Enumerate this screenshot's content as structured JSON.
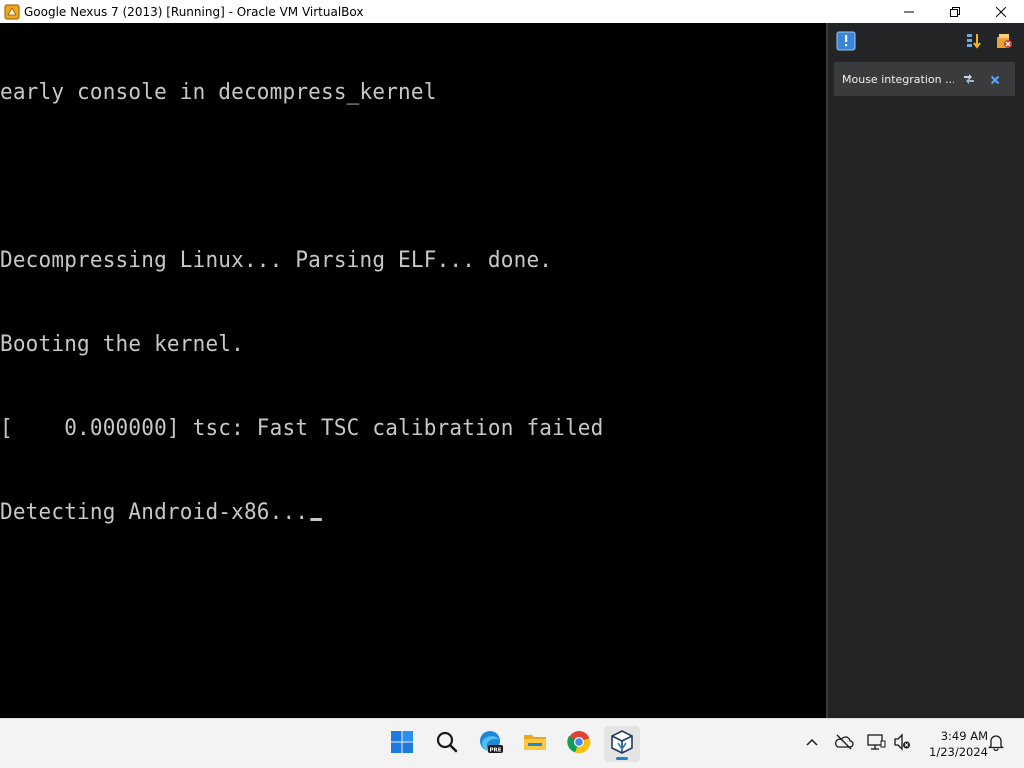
{
  "window": {
    "title": "Google Nexus 7 (2013) [Running] - Oracle VM VirtualBox",
    "app_icon": "virtualbox-vm-icon",
    "controls": [
      "minimize-icon",
      "restore-icon",
      "close-icon"
    ]
  },
  "console": {
    "lines": [
      "early console in decompress_kernel",
      "",
      "Decompressing Linux... Parsing ELF... done.",
      "Booting the kernel.",
      "[    0.000000] tsc: Fast TSC calibration failed",
      "Detecting Android-x86..."
    ],
    "text_color": "#c7c7c7",
    "background": "#000000"
  },
  "notification_pane": {
    "toolbar_icons": [
      "notification-center-icon",
      "sort-icon",
      "clear-all-icon"
    ],
    "notifications": [
      {
        "text": "Mouse integration ...",
        "icons": [
          "mouse-integration-toggle-icon",
          "close-icon"
        ]
      }
    ]
  },
  "taskbar": {
    "apps": [
      "start-icon",
      "search-icon",
      "edge-preview-icon",
      "file-explorer-icon",
      "chrome-icon",
      "virtualbox-icon"
    ],
    "active_app": "virtualbox-icon",
    "tray": [
      "show-hidden-icons-icon",
      "onedrive-icon",
      "network-icon",
      "volume-muted-icon",
      "notifications-bell-icon"
    ],
    "clock": {
      "time": "3:49 AM",
      "date": "1/23/2024"
    }
  }
}
